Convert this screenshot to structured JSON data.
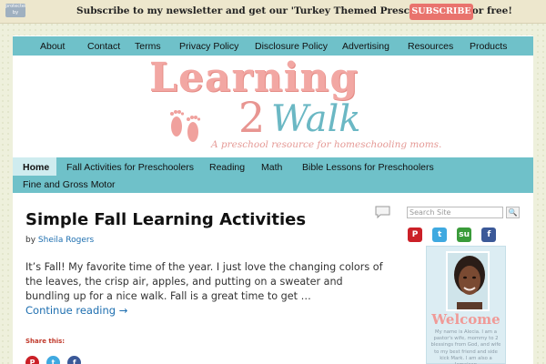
{
  "topbar": {
    "badge_text": "protected by copyscape",
    "message": "Subscribe to my newsletter and get our 'Turkey Themed Preschool Pack' for free!",
    "subscribe_button": "SUBSCRIBE"
  },
  "top_nav": [
    "About",
    "Contact",
    "Terms",
    "Privacy Policy",
    "Disclosure Policy",
    "Advertising",
    "Resources",
    "Products"
  ],
  "logo": {
    "title": "Learning",
    "number": "2",
    "word": "Walk",
    "tagline": "A preschool resource for homeschooling moms."
  },
  "main_nav": [
    "Home",
    "Fall Activities for Preschoolers",
    "Reading",
    "Math",
    "Bible Lessons for Preschoolers",
    "Fine and Gross Motor"
  ],
  "post": {
    "title": "Simple Fall Learning Activities",
    "by": "by",
    "author": "Sheila Rogers",
    "excerpt": "It’s Fall! My favorite time of the year. I just love the changing colors of the leaves, the crisp air, apples, and putting on a sweater and bundling up for a nice walk. Fall is a great time to get …",
    "continue": "Continue reading →",
    "share_label": "Share this:"
  },
  "sidebar": {
    "search_placeholder": "Search Site",
    "welcome_title": "Welcome",
    "welcome_text": "My name is Alecia. I am a pastor's wife, mommy to 2 blessings from God, and wife to my best friend and side kick Mark. I am also a Jamaican"
  },
  "colors": {
    "nav_bg": "#6fc1c9",
    "accent_pink": "#f2a7a3",
    "subscribe_bg": "#e9736d",
    "link_blue": "#1e6fb0"
  },
  "icons": {
    "share": [
      "pinterest-icon",
      "twitter-icon",
      "facebook-icon"
    ],
    "social": [
      "pinterest-icon",
      "twitter-icon",
      "stumbleupon-icon",
      "facebook-icon"
    ]
  }
}
